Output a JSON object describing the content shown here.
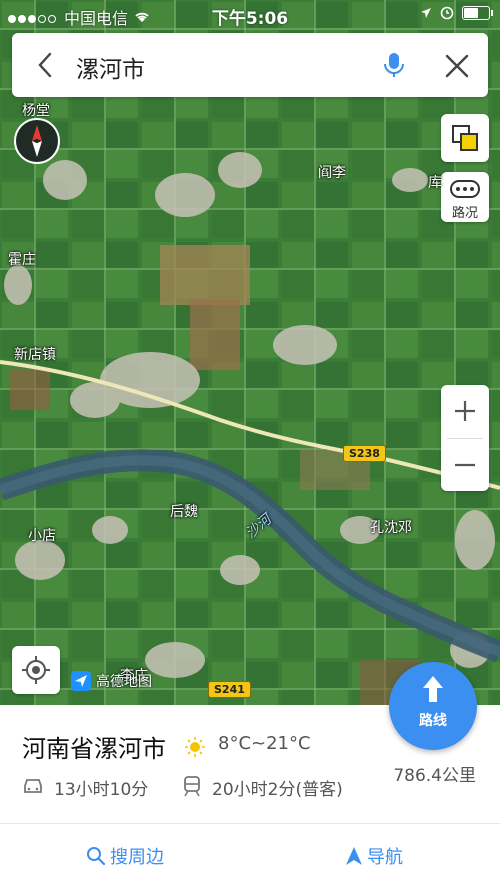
{
  "status_bar": {
    "carrier": "中国电信",
    "time": "下午5:06",
    "signal_dots_filled": 3,
    "battery_level": 0.6
  },
  "search": {
    "title": "漯河市",
    "back_icon": "chevron-left-icon",
    "mic_icon": "microphone-icon",
    "close_icon": "close-icon"
  },
  "map": {
    "labels": {
      "yangtang": "杨堂",
      "yanli": "阎李",
      "ku": "库",
      "huozhuang": "霍庄",
      "xindianzhen": "新店镇",
      "houwei": "后魏",
      "river": "沙河",
      "kongxiandeng": "孔沈邓",
      "xiaodian": "小店",
      "lizhuang": "李庄"
    },
    "roads": {
      "s238": "S238",
      "s241": "S241"
    },
    "controls": {
      "traffic_label": "路况",
      "zoom_in": "+",
      "zoom_out": "−"
    },
    "logo_text": "高德地图"
  },
  "route_button": {
    "label": "路线"
  },
  "info_panel": {
    "place_name": "河南省漯河市",
    "weather": "8°C~21°C",
    "drive_time": "13小时10分",
    "rail_time": "20小时2分(普客)",
    "distance": "786.4公里",
    "nearby_label": "搜周边",
    "navigate_label": "导航"
  },
  "colors": {
    "accent": "#3b8ff0",
    "shield": "#f3c515"
  }
}
